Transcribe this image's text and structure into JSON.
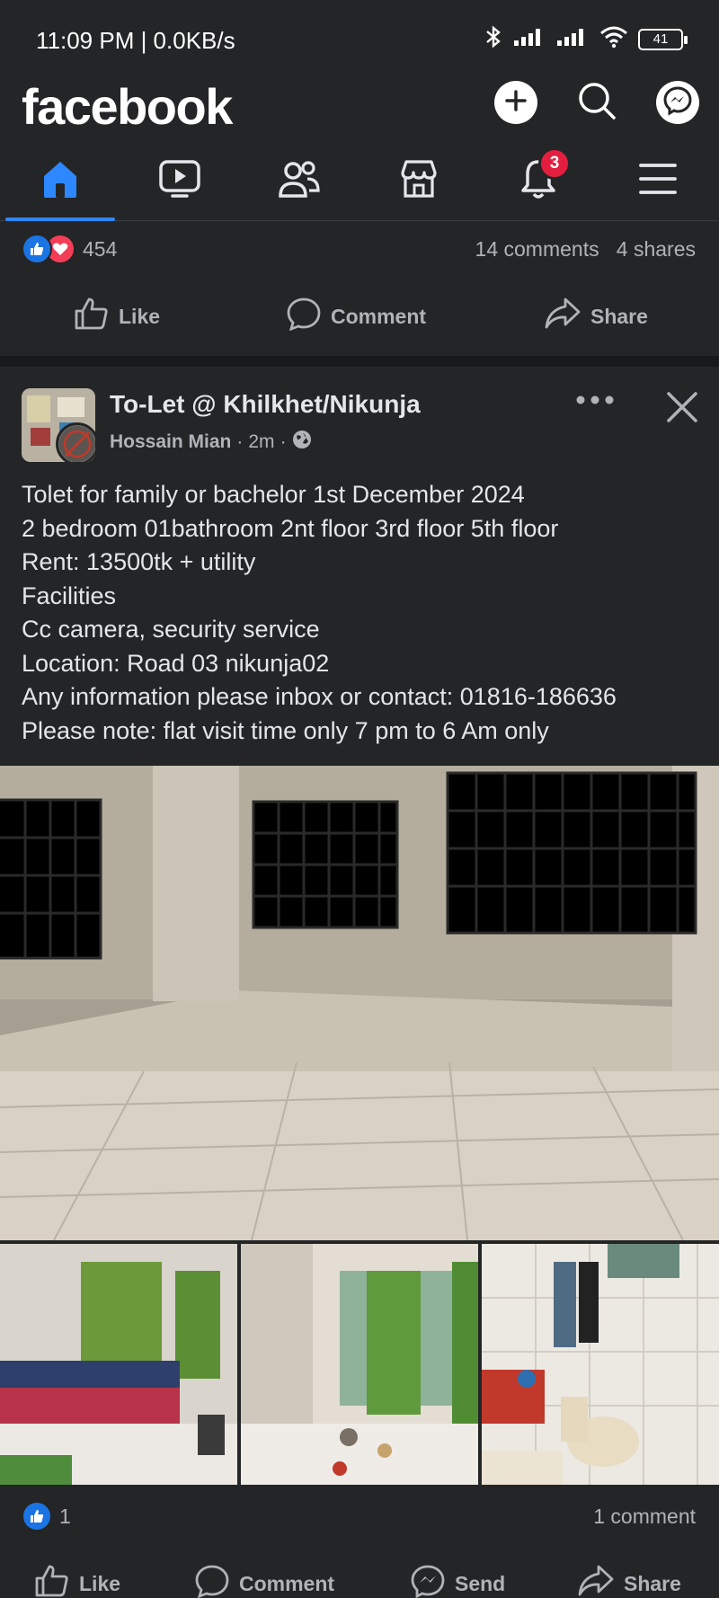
{
  "status": {
    "time": "11:09 PM | 0.0KB/s",
    "battery": "41"
  },
  "app": {
    "logo": "facebook",
    "top_icons": [
      "plus-icon",
      "search-icon",
      "messenger-icon"
    ]
  },
  "nav": {
    "items": [
      "home-icon",
      "video-icon",
      "friends-icon",
      "marketplace-icon",
      "notifications-icon",
      "menu-icon"
    ],
    "notification_badge": "3",
    "active_color": "#2d88ff"
  },
  "prev_post": {
    "reaction_count": "454",
    "comments": "14 comments",
    "shares": "4 shares",
    "actions": {
      "like": "Like",
      "comment": "Comment",
      "share": "Share"
    }
  },
  "post": {
    "group": "To-Let @ Khilkhet/Nikunja",
    "author": "Hossain Mian",
    "time": "2m",
    "lines": [
      "Tolet for family or bachelor 1st December 2024",
      "2 bedroom 01bathroom 2nt floor 3rd floor 5th floor",
      "Rent: 13500tk + utility",
      "Facilities",
      "Cc camera, security service",
      "Location: Road 03 nikunja02",
      "Any information please inbox or contact: 01816-186636",
      "Please note: flat visit time only 7 pm to 6 Am only"
    ],
    "reaction_count": "1",
    "comments": "1 comment",
    "actions": {
      "like": "Like",
      "comment": "Comment",
      "send": "Send",
      "share": "Share"
    }
  },
  "colors": {
    "background": "#242526",
    "text": "#e4e6eb",
    "secondary_text": "#b0b3b8",
    "like_blue": "#1b74e4",
    "love_red": "#f33e58",
    "badge_red": "#e41e3f"
  }
}
